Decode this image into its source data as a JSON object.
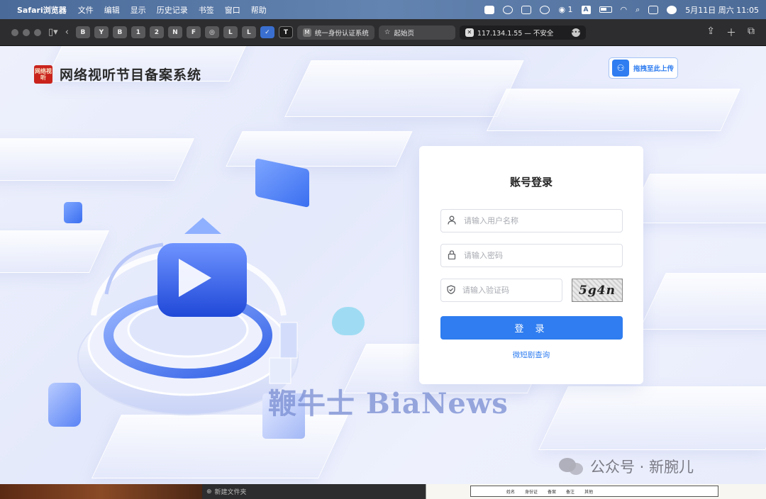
{
  "menubar": {
    "app": "Safari浏览器",
    "items": [
      "文件",
      "编辑",
      "显示",
      "历史记录",
      "书签",
      "窗口",
      "帮助"
    ],
    "wechat_count": "1",
    "ime": "A",
    "datetime": "5月11日 周六 11:05"
  },
  "toolbar": {
    "favorites": [
      "B",
      "Y",
      "B",
      "1",
      "2",
      "N",
      "F",
      "◎",
      "L",
      "L",
      "✓",
      "T"
    ],
    "tabs": [
      {
        "icon": "M",
        "label": "统一身份认证系统"
      },
      {
        "icon": "☆",
        "label": "起始页"
      },
      {
        "icon": "✕",
        "label": "117.134.1.55 — 不安全"
      }
    ]
  },
  "page": {
    "seal_text": "网络视听",
    "title": "网络视听节目备案系统",
    "upload_label": "拖拽至此上传"
  },
  "login": {
    "heading": "账号登录",
    "username_placeholder": "请输入用户名称",
    "password_placeholder": "请输入密码",
    "captcha_placeholder": "请输入验证码",
    "captcha_text": "5g4n",
    "submit_label": "登 录",
    "link_label": "微短剧查询"
  },
  "overlays": {
    "watermark": "鞭牛士 BiaNews",
    "wechat_account": "公众号 · 新腕儿"
  },
  "bottom": {
    "new_folder": "新建文件夹",
    "doc_cols": [
      "姓名",
      "身份证",
      "备案",
      "备注",
      "其他"
    ]
  },
  "colors": {
    "primary": "#2f7df0",
    "menubar": "#5577a6",
    "seal": "#c9231c"
  }
}
